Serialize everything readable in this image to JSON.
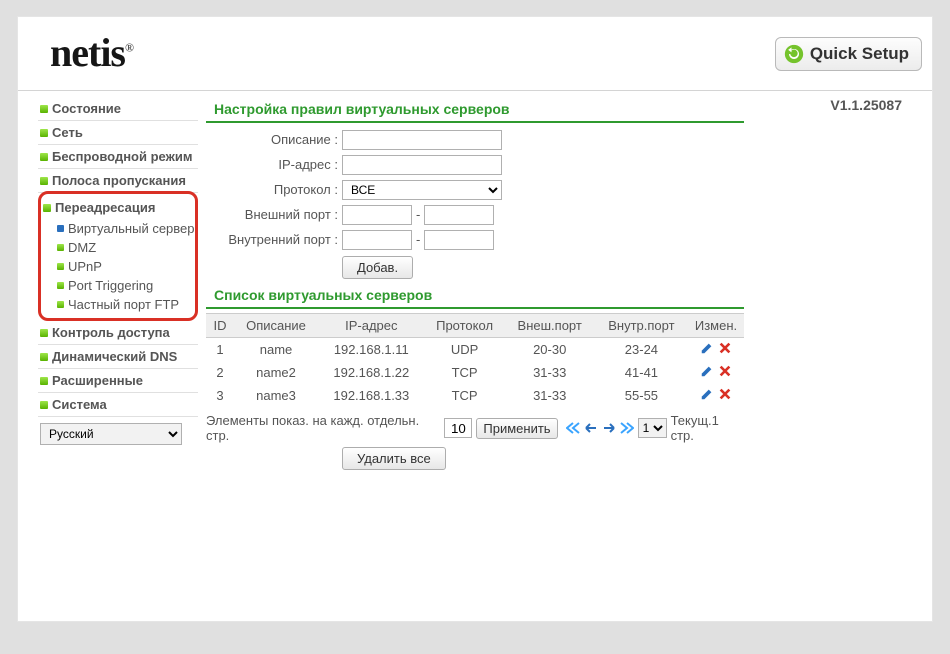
{
  "brand": "netis",
  "quick_setup": "Quick Setup",
  "version": "V1.1.25087",
  "language": {
    "selected": "Русский"
  },
  "nav": {
    "status": "Состояние",
    "network": "Сеть",
    "wireless": "Беспроводной режим",
    "bandwidth": "Полоса пропускания",
    "forwarding": "Переадресация",
    "sub": {
      "vserver": "Виртуальный сервер",
      "dmz": "DMZ",
      "upnp": "UPnP",
      "pt": "Port Triggering",
      "ftp": "Частный порт FTP"
    },
    "access": "Контроль доступа",
    "ddns": "Динамический DNS",
    "advanced": "Расширенные",
    "system": "Система"
  },
  "form": {
    "title": "Настройка правил виртуальных серверов",
    "desc_label": "Описание :",
    "ip_label": "IP-адрес :",
    "proto_label": "Протокол :",
    "proto_value": "ВСЕ",
    "extport_label": "Внешний порт :",
    "intport_label": "Внутренний порт :",
    "add_btn": "Добав."
  },
  "list": {
    "title": "Список виртуальных серверов",
    "columns": {
      "id": "ID",
      "desc": "Описание",
      "ip": "IP-адрес",
      "proto": "Протокол",
      "ext": "Внеш.порт",
      "int": "Внутр.порт",
      "act": "Измен."
    },
    "rows": [
      {
        "id": "1",
        "desc": "name",
        "ip": "192.168.1.11",
        "proto": "UDP",
        "ext": "20-30",
        "int": "23-24"
      },
      {
        "id": "2",
        "desc": "name2",
        "ip": "192.168.1.22",
        "proto": "TCP",
        "ext": "31-33",
        "int": "41-41"
      },
      {
        "id": "3",
        "desc": "name3",
        "ip": "192.168.1.33",
        "proto": "TCP",
        "ext": "31-33",
        "int": "55-55"
      }
    ]
  },
  "pager": {
    "per_page_label": "Элементы показ. на кажд. отдельн. стр.",
    "per_page_value": "10",
    "apply": "Применить",
    "page_value": "1",
    "cur_label": "Текущ.1 стр.",
    "delete_all": "Удалить все"
  }
}
